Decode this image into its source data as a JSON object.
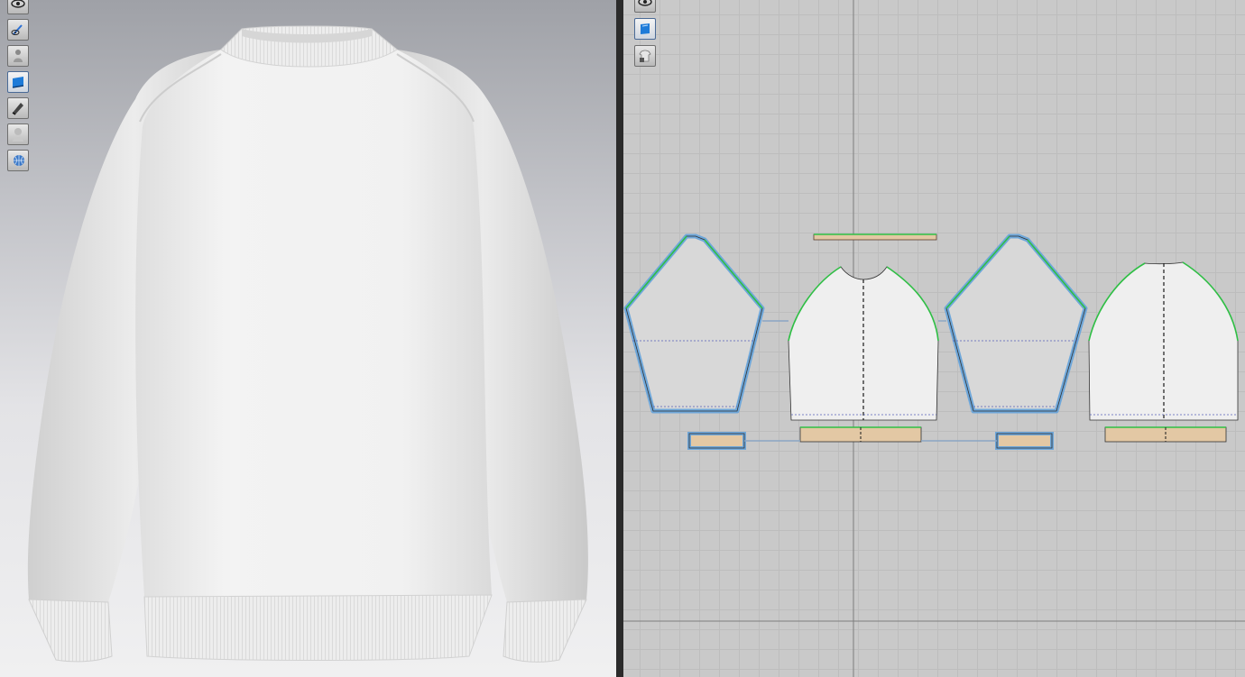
{
  "viewport_3d": {
    "toolbar": [
      {
        "icon": "eye-icon",
        "active": false
      },
      {
        "icon": "avatar-pose-eye-icon",
        "active": false
      },
      {
        "icon": "avatar-show-icon",
        "active": false
      },
      {
        "icon": "garment-blue-icon",
        "active": true
      },
      {
        "icon": "texture-surface-icon",
        "active": false
      },
      {
        "icon": "avatar-silhouette-icon",
        "active": false
      },
      {
        "icon": "globe-mesh-icon",
        "active": false
      }
    ],
    "garment": "sweatshirt"
  },
  "viewport_2d": {
    "toolbar": [
      {
        "icon": "eye-icon",
        "active": false
      },
      {
        "icon": "show-pattern-icon",
        "active": true
      },
      {
        "icon": "lock-shirt-icon",
        "active": false
      }
    ],
    "colors": {
      "background": "#c9c9c9",
      "grid": "#bdbdbd",
      "selected_outline": "#6ea7da",
      "seam_green": "#2fbf45",
      "rib_fill": "#e3c8a4"
    }
  }
}
